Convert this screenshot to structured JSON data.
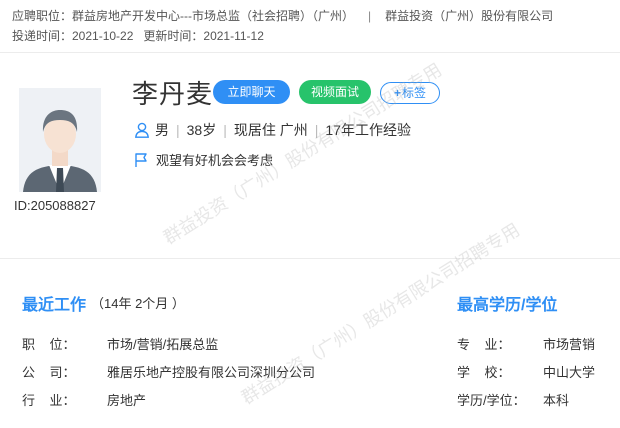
{
  "job": {
    "applied_position": "应聘职位：群益房地产开发中心---市场总监（社会招聘）（广州）",
    "separator": "|",
    "company": "群益投资（广州）股份有限公司",
    "delivered": "投递时间：2021-10-22",
    "updated": "更新时间：2021-11-12"
  },
  "profile": {
    "name": "李丹麦",
    "id": "ID:205088827",
    "gender": "男",
    "age": "38岁",
    "residence": "现居住 广州",
    "experience": "17年工作经验",
    "job_status": "观望有好机会会考虑"
  },
  "actions": {
    "chat": "立即聊天",
    "video": "视频面试",
    "tag": "标签",
    "tag_plus": "+"
  },
  "recent_work": {
    "title": "最近工作",
    "duration": "（14年 2个月 ）",
    "position_label": "职    位：",
    "position": "市场/营销/拓展总监",
    "company_label": "公    司：",
    "company": "雅居乐地产控股有限公司深圳分公司",
    "industry_label": "行    业：",
    "industry": "房地产"
  },
  "education": {
    "title": "最高学历/学位",
    "major_label": "专    业：",
    "major": "市场营销",
    "school_label": "学    校：",
    "school": "中山大学",
    "degree_label": "学历/学位：",
    "degree": "本科"
  },
  "watermarks": {
    "line1": "群益投资（广州）股份有限公司招聘专用",
    "line2": "群益投资（广州）股份有限公司招聘专用"
  },
  "colors": {
    "accent": "#2f8ff5",
    "video": "#27c36b"
  },
  "icons": {
    "person": "person-outline-icon",
    "flag": "flag-outline-icon"
  }
}
